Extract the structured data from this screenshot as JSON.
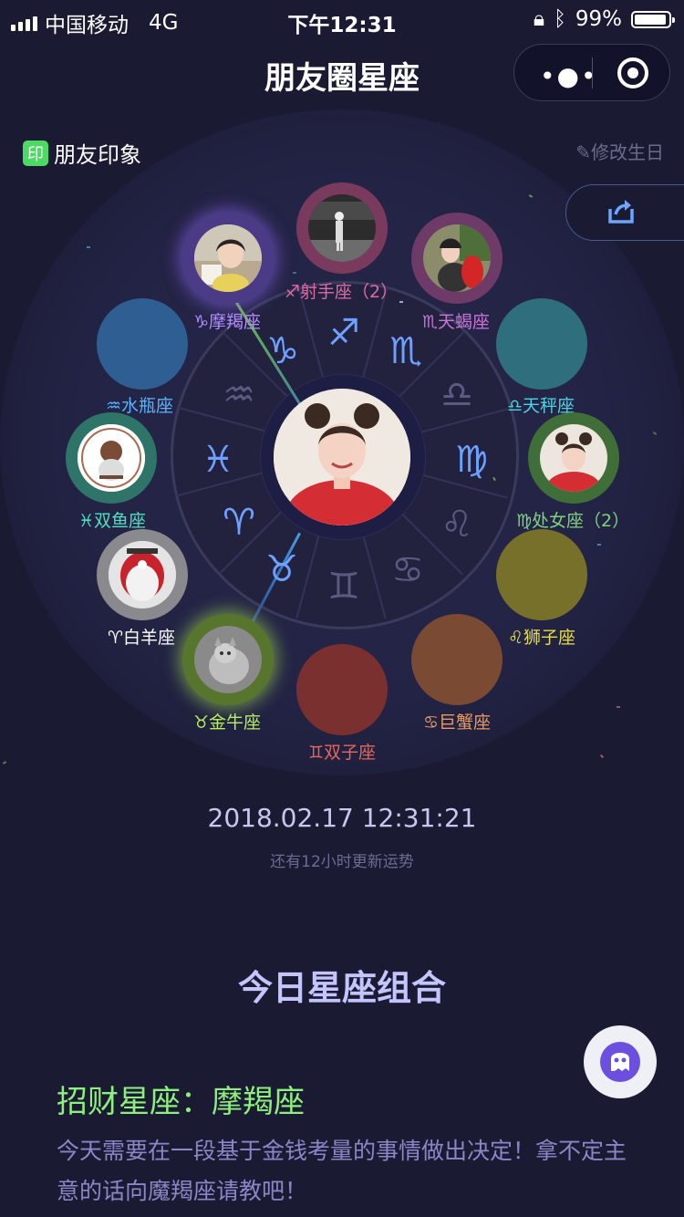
{
  "status_bar": {
    "carrier": "中国移动",
    "network": "4G",
    "time": "下午12:31",
    "battery": "99%"
  },
  "nav": {
    "title": "朋友圈星座",
    "more_icon": "more-dots-icon",
    "close_icon": "record-target-icon"
  },
  "header": {
    "impression_badge": "印",
    "impression_label": "朋友印象",
    "edit_birthday": "修改生日"
  },
  "wheel_symbols": [
    "♑",
    "♐",
    "♏",
    "♎",
    "♍",
    "♌",
    "♋",
    "♊",
    "♉",
    "♈",
    "♓",
    "♒"
  ],
  "signs": {
    "capricorn": {
      "label": "♑摩羯座",
      "color": "#b38cff"
    },
    "sagittarius": {
      "label": "♐射手座（2）",
      "color": "#e06aa6"
    },
    "scorpio": {
      "label": "♏天蝎座",
      "color": "#c974d6"
    },
    "libra": {
      "label": "♎天秤座",
      "color": "#49d6e0"
    },
    "virgo": {
      "label": "♍处女座（2）",
      "color": "#7fd47a"
    },
    "leo": {
      "label": "♌狮子座",
      "color": "#e5df4e"
    },
    "cancer": {
      "label": "♋巨蟹座",
      "color": "#e89a62"
    },
    "gemini": {
      "label": "♊双子座",
      "color": "#e8665a"
    },
    "taurus": {
      "label": "♉金牛座",
      "color": "#b7ef5c"
    },
    "aries": {
      "label": "♈白羊座",
      "color": "#ffffff"
    },
    "pisces": {
      "label": "♓双鱼座",
      "color": "#4fe0c0"
    },
    "aquarius": {
      "label": "♒水瓶座",
      "color": "#5ab3ff"
    }
  },
  "datetime": "2018.02.17 12:31:21",
  "update_note": "还有12小时更新运势",
  "combo_title": "今日星座组合",
  "fortune": {
    "title": "招财星座：摩羯座",
    "description": "今天需要在一段基于金钱考量的事情做出决定！拿不定主意的话向魔羯座请教吧！"
  },
  "colors": {
    "background": "#1a1a33",
    "accent_green": "#8ef07c",
    "accent_purple": "#c4c4ff"
  }
}
